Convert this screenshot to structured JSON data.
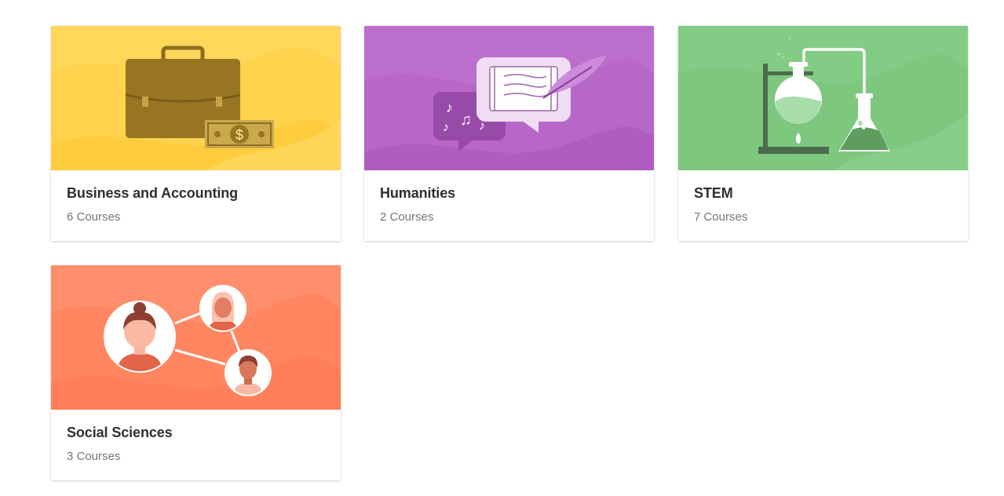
{
  "categories": [
    {
      "id": "business",
      "title": "Business and Accounting",
      "count": "6 Courses",
      "color": "#FFD34E",
      "icon": "briefcase-money-icon"
    },
    {
      "id": "humanities",
      "title": "Humanities",
      "count": "2 Courses",
      "color": "#B767C8",
      "icon": "speech-bubbles-quill-icon"
    },
    {
      "id": "stem",
      "title": "STEM",
      "count": "7 Courses",
      "color": "#7DC77F",
      "icon": "chemistry-flask-icon"
    },
    {
      "id": "social",
      "title": "Social Sciences",
      "count": "3 Courses",
      "color": "#FF8661",
      "icon": "people-network-icon"
    }
  ],
  "money_symbol": "$"
}
